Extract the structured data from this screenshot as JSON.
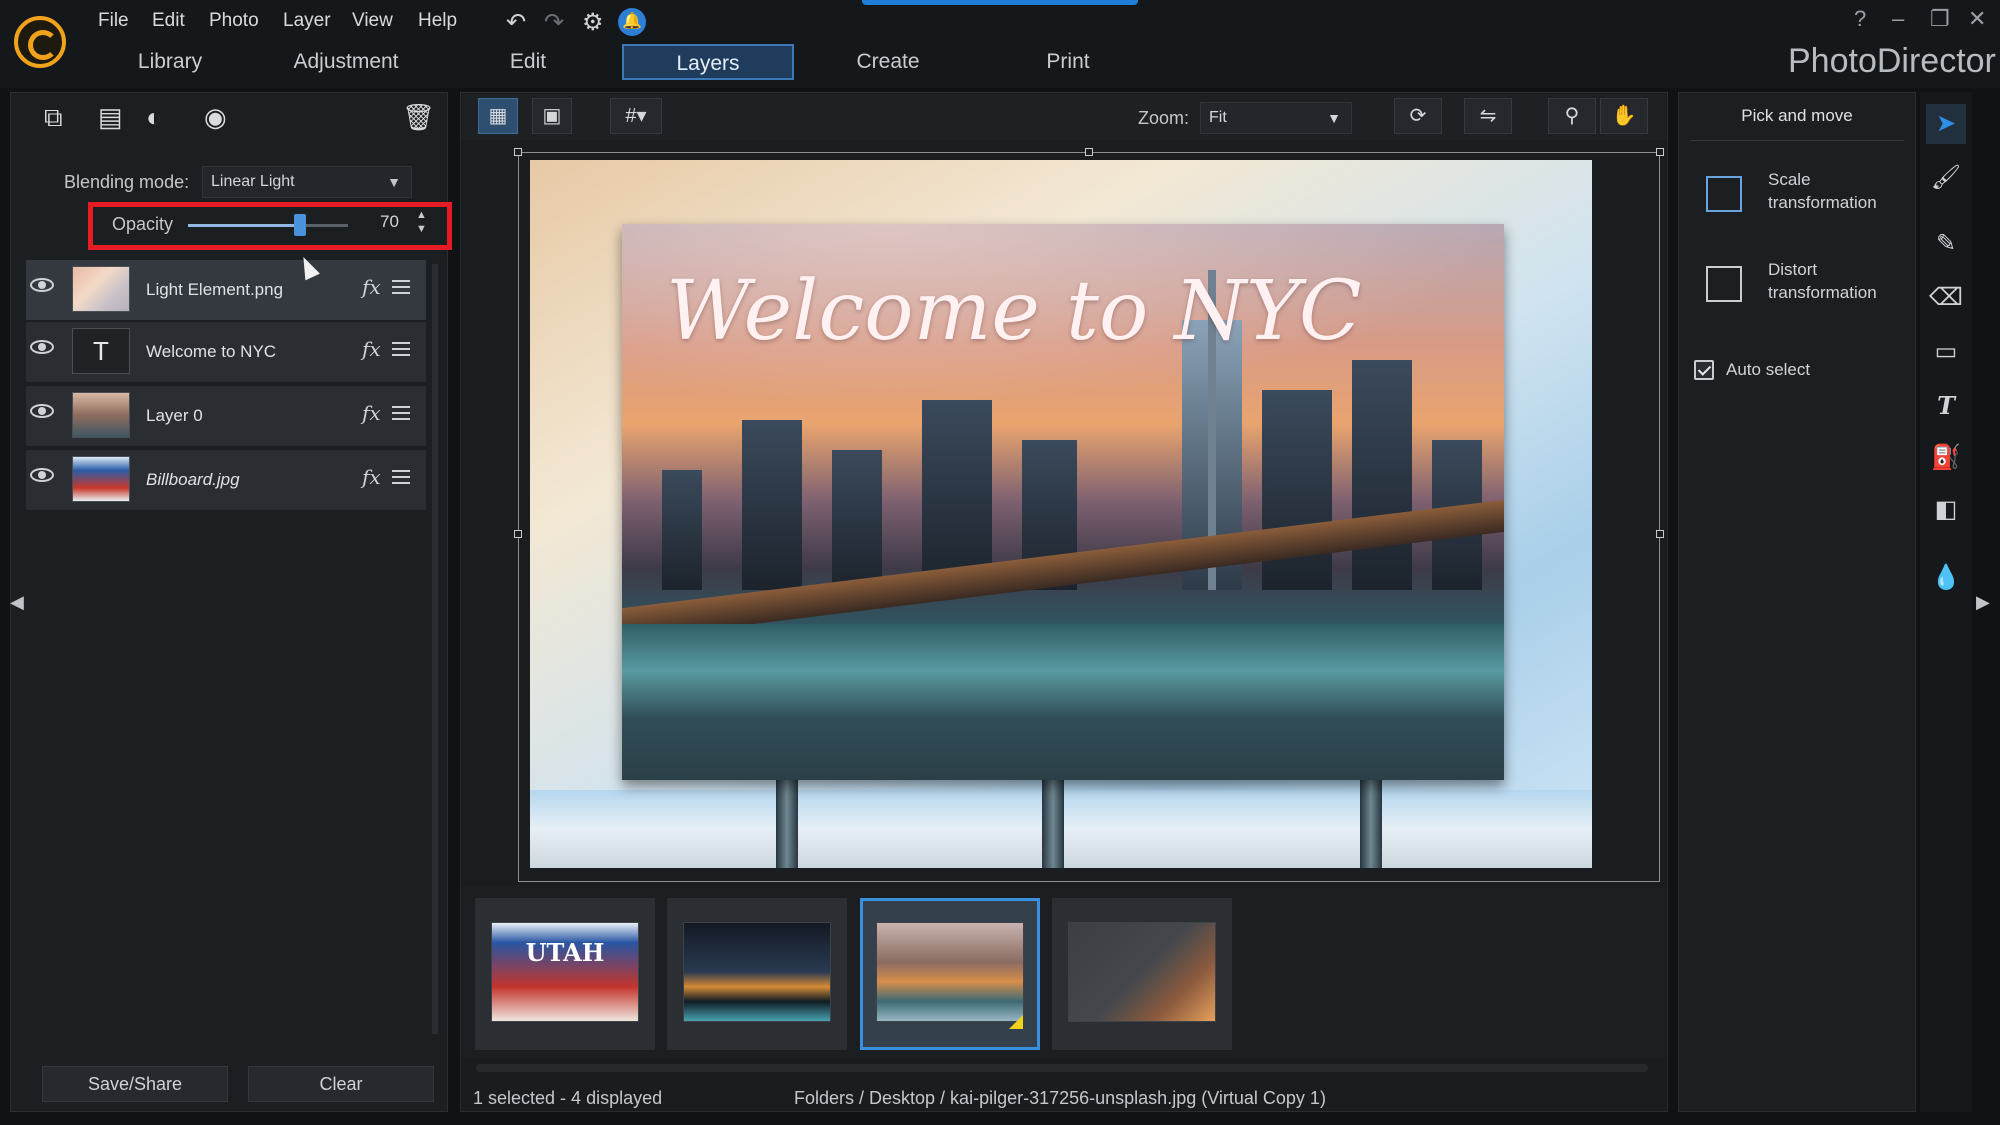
{
  "app": {
    "name": "PhotoDirector"
  },
  "menu": [
    "File",
    "Edit",
    "Photo",
    "Layer",
    "View",
    "Help"
  ],
  "toolbar_icons": [
    "undo-icon",
    "redo-icon",
    "settings-icon",
    "notification-icon"
  ],
  "window_controls": {
    "help": "?",
    "minimize": "–",
    "restore": "❐",
    "close": "✕"
  },
  "modules": [
    "Library",
    "Adjustment",
    "Edit",
    "Layers",
    "Create",
    "Print"
  ],
  "active_module": "Layers",
  "layers_panel": {
    "blending_label": "Blending mode:",
    "blending_value": "Linear Light",
    "opacity_label": "Opacity",
    "opacity_value": "70",
    "opacity_fraction": 0.7,
    "layers": [
      {
        "name": "Light Element.png",
        "fx": "fx",
        "selected": true
      },
      {
        "name": "Welcome to NYC",
        "fx": "fx",
        "selected": false,
        "type_glyph": "T"
      },
      {
        "name": "Layer 0",
        "fx": "fx",
        "selected": false
      },
      {
        "name": "Billboard.jpg",
        "fx": "fx",
        "selected": false
      }
    ],
    "save_label": "Save/Share",
    "clear_label": "Clear"
  },
  "viewer": {
    "zoom_label": "Zoom:",
    "zoom_value": "Fit",
    "canvas_text": "Welcome to NYC"
  },
  "filmstrip": {
    "thumbs": [
      "utah-billboard",
      "nyc-night-skyline",
      "nyc-bridge-skyline",
      "light-element"
    ],
    "utah_text": "UTAH"
  },
  "status": {
    "selection": "1 selected - 4 displayed",
    "path": "Folders / Desktop / kai-pilger-317256-unsplash.jpg (Virtual Copy 1)"
  },
  "right_panel": {
    "title": "Pick and move",
    "scale_label": "Scale transformation",
    "distort_label": "Distort transformation",
    "auto_select_label": "Auto select",
    "auto_select_checked": true
  },
  "colors": {
    "accent": "#3a8fe0",
    "highlight_box": "#e51c23",
    "brand_orange": "#f0a21a"
  }
}
